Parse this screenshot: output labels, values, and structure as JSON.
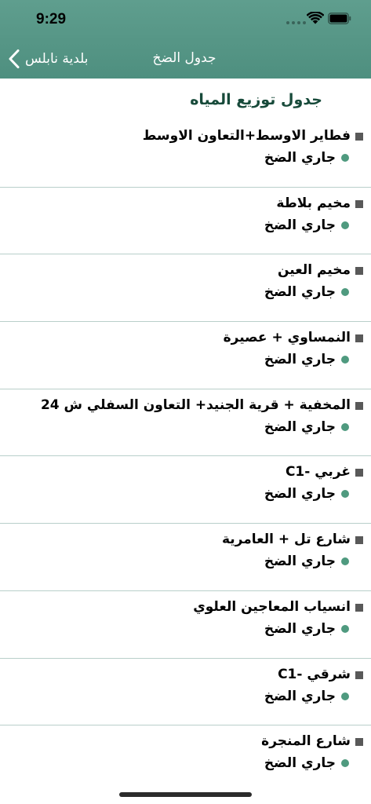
{
  "status_bar": {
    "time": "9:29"
  },
  "nav": {
    "back_label": "بلدية نابلس",
    "title": "جدول الضخ"
  },
  "page": {
    "heading": "جدول توزيع المياه"
  },
  "colors": {
    "header": "#5f9e8e",
    "status_dot": "#4f9a7f",
    "heading": "#174a3a",
    "divider": "#b9cfca"
  },
  "items": [
    {
      "name": "فطاير الاوسط+التعاون الاوسط",
      "status": "جاري الضخ"
    },
    {
      "name": "مخيم بلاطة",
      "status": "جاري الضخ"
    },
    {
      "name": "مخيم العين",
      "status": "جاري الضخ"
    },
    {
      "name": "النمساوي + عصيرة",
      "status": "جاري الضخ"
    },
    {
      "name": "المخفية + قرية الجنيد+ التعاون السفلي ش 24",
      "status": "جاري الضخ"
    },
    {
      "name": "غربي -C1",
      "status": "جاري الضخ"
    },
    {
      "name": "شارع تل + العامرية",
      "status": "جاري الضخ"
    },
    {
      "name": "انسياب المعاجين العلوي",
      "status": "جاري الضخ"
    },
    {
      "name": "شرقي -C1",
      "status": "جاري الضخ"
    },
    {
      "name": "شارع المنجرة",
      "status": "جاري الضخ"
    }
  ]
}
